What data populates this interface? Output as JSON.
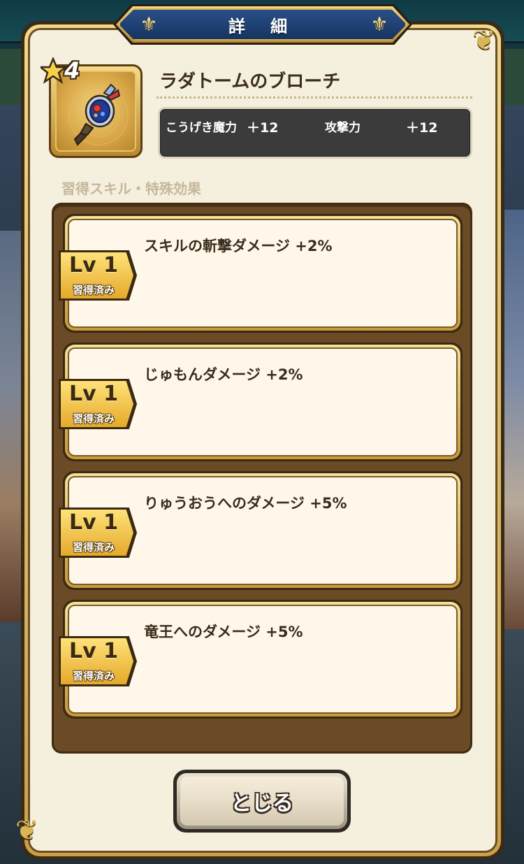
{
  "dialog": {
    "title": "詳 細",
    "close_label": "とじる"
  },
  "item": {
    "name": "ラダトームのブローチ",
    "rarity_stars": "4",
    "icon": "brooch-icon"
  },
  "stats": [
    {
      "label": "こうげき魔力",
      "value": "＋12"
    },
    {
      "label": "攻撃力",
      "value": "＋12"
    }
  ],
  "section": {
    "heading": "習得スキル・特殊効果"
  },
  "skills": [
    {
      "level": "Lv 1",
      "status": "習得済み",
      "text": "スキルの斬撃ダメージ +2%"
    },
    {
      "level": "Lv 1",
      "status": "習得済み",
      "text": "じゅもんダメージ +2%"
    },
    {
      "level": "Lv 1",
      "status": "習得済み",
      "text": "りゅうおうへのダメージ +5%"
    },
    {
      "level": "Lv 1",
      "status": "習得済み",
      "text": "竜王へのダメージ +5%"
    }
  ],
  "colors": {
    "panel_cream": "#f5efdd",
    "title_blue": "#1f4176",
    "gold": "#d8b556",
    "skill_panel_brown": "#6b4a26",
    "stat_box_dark": "#3b3b3b"
  }
}
